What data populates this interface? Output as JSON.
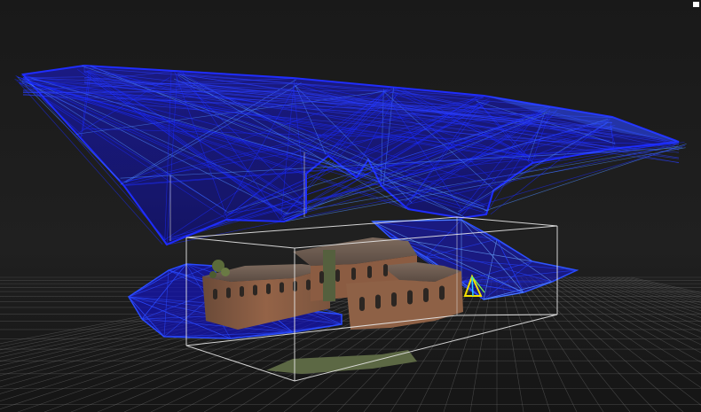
{
  "viewer": {
    "background_color": "#1e1e1e",
    "ground_grid": true,
    "grid_color": "#6a6a6a",
    "mesh_color": "#1010dd",
    "mesh_highlight_color": "#3a7bff",
    "bounding_box_color": "#e6e6e6",
    "model_description_colors": {
      "roof": "#6e5a4e",
      "brick": "#8a5a3e",
      "window": "#2c2622",
      "vegetation": "#5a6a3a"
    },
    "corner_indicator_color": "#ffffff"
  }
}
